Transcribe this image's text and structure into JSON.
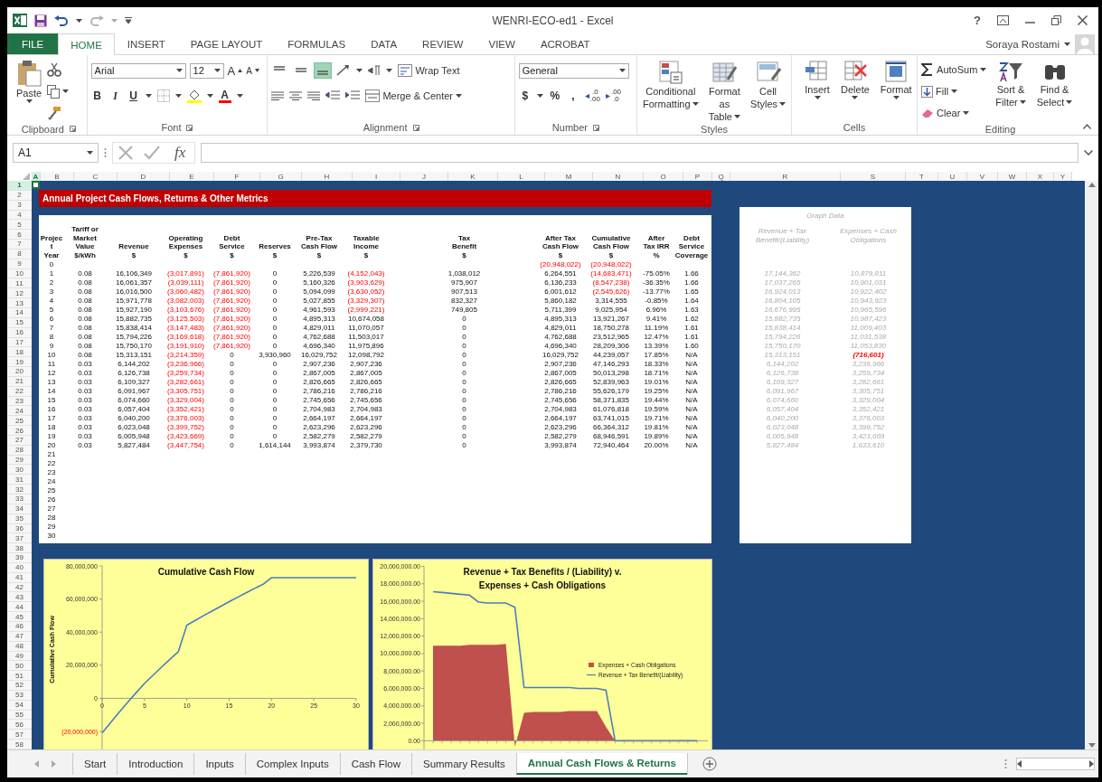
{
  "title_bar": {
    "title": "WENRI-ECO-ed1 - Excel",
    "help": "?"
  },
  "ribbon": {
    "tabs": [
      {
        "label": "FILE",
        "kind": "file",
        "selected": false
      },
      {
        "label": "HOME",
        "kind": "tab",
        "selected": true
      },
      {
        "label": "INSERT",
        "kind": "tab",
        "selected": false
      },
      {
        "label": "PAGE LAYOUT",
        "kind": "tab",
        "selected": false
      },
      {
        "label": "FORMULAS",
        "kind": "tab",
        "selected": false
      },
      {
        "label": "DATA",
        "kind": "tab",
        "selected": false
      },
      {
        "label": "REVIEW",
        "kind": "tab",
        "selected": false
      },
      {
        "label": "VIEW",
        "kind": "tab",
        "selected": false
      },
      {
        "label": "ACROBAT",
        "kind": "tab",
        "selected": false
      }
    ],
    "user": "Soraya Rostami",
    "clipboard": {
      "label": "Clipboard",
      "paste": "Paste"
    },
    "font": {
      "label": "Font",
      "family": "Arial",
      "size": "12",
      "grow": "A",
      "shrink": "A",
      "bold": "B",
      "italic": "I",
      "underline": "U",
      "color_letter": "A"
    },
    "alignment": {
      "label": "Alignment",
      "vertical": [
        {
          "selected": false
        },
        {
          "selected": false
        },
        {
          "selected": true
        }
      ],
      "wrap": "Wrap Text",
      "merge": "Merge & Center"
    },
    "number": {
      "label": "Number",
      "format": "General",
      "currency": "$",
      "percent": "%",
      "comma": ",",
      "decimals": [
        {
          "top": ".0",
          "bottom": ".00"
        },
        {
          "top": ".00",
          "bottom": ".0"
        }
      ]
    },
    "styles": {
      "label": "Styles",
      "buttons": [
        {
          "lines": [
            "Conditional",
            "Formatting"
          ]
        },
        {
          "lines": [
            "Format as",
            "Table"
          ]
        },
        {
          "lines": [
            "Cell",
            "Styles"
          ]
        }
      ]
    },
    "cells": {
      "label": "Cells",
      "buttons": [
        "Insert",
        "Delete",
        "Format"
      ]
    },
    "editing": {
      "label": "Editing",
      "autosum": "AutoSum",
      "fill": "Fill",
      "clear": "Clear",
      "sort": [
        "Sort &",
        "Filter"
      ],
      "find": [
        "Find &",
        "Select"
      ]
    }
  },
  "formula_bar": {
    "name_box": "A1",
    "fx": "fx"
  },
  "columns": [
    {
      "label": "A",
      "selected": true
    },
    {
      "label": "B",
      "selected": false
    },
    {
      "label": "C",
      "selected": false
    },
    {
      "label": "D",
      "selected": false
    },
    {
      "label": "E",
      "selected": false
    },
    {
      "label": "F",
      "selected": false
    },
    {
      "label": "G",
      "selected": false
    },
    {
      "label": "H",
      "selected": false
    },
    {
      "label": "I",
      "selected": false
    },
    {
      "label": "J",
      "selected": false
    },
    {
      "label": "K",
      "selected": false
    },
    {
      "label": "L",
      "selected": false
    },
    {
      "label": "M",
      "selected": false
    },
    {
      "label": "N",
      "selected": false
    },
    {
      "label": "O",
      "selected": false
    },
    {
      "label": "P",
      "selected": false
    },
    {
      "label": "Q",
      "selected": false
    },
    {
      "label": "R",
      "selected": false
    },
    {
      "label": "S",
      "selected": false
    },
    {
      "label": "T",
      "selected": false
    },
    {
      "label": "U",
      "selected": false
    },
    {
      "label": "V",
      "selected": false
    },
    {
      "label": "W",
      "selected": false
    },
    {
      "label": "X",
      "selected": false
    },
    {
      "label": "Y",
      "selected": false
    }
  ],
  "row_headers": [
    {
      "label": "1",
      "selected": true
    },
    {
      "label": "2",
      "selected": false
    },
    {
      "label": "3",
      "selected": false
    },
    {
      "label": "4",
      "selected": false
    },
    {
      "label": "5",
      "selected": false
    },
    {
      "label": "6",
      "selected": false
    },
    {
      "label": "7",
      "selected": false
    },
    {
      "label": "8",
      "selected": false
    },
    {
      "label": "9",
      "selected": false
    },
    {
      "label": "10",
      "selected": false
    },
    {
      "label": "11",
      "selected": false
    },
    {
      "label": "12",
      "selected": false
    },
    {
      "label": "13",
      "selected": false
    },
    {
      "label": "14",
      "selected": false
    },
    {
      "label": "15",
      "selected": false
    },
    {
      "label": "16",
      "selected": false
    },
    {
      "label": "17",
      "selected": false
    },
    {
      "label": "18",
      "selected": false
    },
    {
      "label": "19",
      "selected": false
    },
    {
      "label": "20",
      "selected": false
    },
    {
      "label": "21",
      "selected": false
    },
    {
      "label": "22",
      "selected": false
    },
    {
      "label": "23",
      "selected": false
    },
    {
      "label": "24",
      "selected": false
    },
    {
      "label": "25",
      "selected": false
    },
    {
      "label": "26",
      "selected": false
    },
    {
      "label": "27",
      "selected": false
    },
    {
      "label": "28",
      "selected": false
    },
    {
      "label": "29",
      "selected": false
    },
    {
      "label": "30",
      "selected": false
    },
    {
      "label": "31",
      "selected": false
    },
    {
      "label": "32",
      "selected": false
    },
    {
      "label": "33",
      "selected": false
    },
    {
      "label": "34",
      "selected": false
    },
    {
      "label": "35",
      "selected": false
    },
    {
      "label": "36",
      "selected": false
    },
    {
      "label": "37",
      "selected": false
    },
    {
      "label": "38",
      "selected": false
    },
    {
      "label": "39",
      "selected": false
    },
    {
      "label": "40",
      "selected": false
    },
    {
      "label": "41",
      "selected": false
    },
    {
      "label": "42",
      "selected": false
    },
    {
      "label": "43",
      "selected": false
    },
    {
      "label": "44",
      "selected": false
    },
    {
      "label": "45",
      "selected": false
    },
    {
      "label": "46",
      "selected": false
    },
    {
      "label": "47",
      "selected": false
    },
    {
      "label": "48",
      "selected": false
    },
    {
      "label": "49",
      "selected": false
    },
    {
      "label": "50",
      "selected": false
    },
    {
      "label": "51",
      "selected": false
    },
    {
      "label": "52",
      "selected": false
    },
    {
      "label": "53",
      "selected": false
    },
    {
      "label": "54",
      "selected": false
    },
    {
      "label": "55",
      "selected": false
    },
    {
      "label": "56",
      "selected": false
    },
    {
      "label": "57",
      "selected": false
    },
    {
      "label": "58",
      "selected": false
    }
  ],
  "report": {
    "title": "Annual Project Cash Flows, Returns & Other Metrics",
    "headers": [
      {
        "lines": [
          "Projec",
          "t",
          "Year"
        ]
      },
      {
        "lines": [
          "Tariff or",
          "Market",
          "Value",
          "$/kWh"
        ]
      },
      {
        "lines": [
          "Revenue",
          "$"
        ]
      },
      {
        "lines": [
          "Operating",
          "Expenses",
          "$"
        ]
      },
      {
        "lines": [
          "Debt",
          "Service",
          "$"
        ]
      },
      {
        "lines": [
          "Reserves",
          "$"
        ]
      },
      {
        "lines": [
          "Pre-Tax",
          "Cash Flow",
          "$"
        ]
      },
      {
        "lines": [
          "Taxable",
          "Income",
          "$"
        ]
      },
      {
        "lines": [
          "Tax",
          "Benefit",
          "$"
        ]
      },
      {
        "lines": [
          "After Tax",
          "Cash Flow",
          "$"
        ]
      },
      {
        "lines": [
          "Cumulative",
          "Cash Flow",
          "$"
        ]
      },
      {
        "lines": [
          "After",
          "Tax IRR",
          "%"
        ]
      },
      {
        "lines": [
          "Debt",
          "Service",
          "Coverage"
        ]
      }
    ],
    "rows": [
      {
        "year": "0",
        "kind": "opening",
        "cells": [
          {
            "v": "(20,948,022)",
            "red": true
          },
          {
            "v": "(20,948,022)",
            "red": true
          }
        ]
      },
      {
        "year": "1",
        "kind": "data",
        "cells": [
          {
            "v": "0.08",
            "red": false
          },
          {
            "v": "16,106,349",
            "red": false
          },
          {
            "v": "(3,017,891)",
            "red": true
          },
          {
            "v": "(7,861,920)",
            "red": true
          },
          {
            "v": "0",
            "red": false
          },
          {
            "v": "5,226,539",
            "red": false
          },
          {
            "v": "(4,152,043)",
            "red": true
          },
          {
            "v": "1,038,012",
            "red": false
          },
          {
            "v": "6,264,551",
            "red": false
          },
          {
            "v": "(14,683,471)",
            "red": true
          },
          {
            "v": "-75.05%",
            "red": false
          },
          {
            "v": "1.66",
            "red": false
          }
        ]
      },
      {
        "year": "2",
        "kind": "data",
        "cells": [
          {
            "v": "0.08",
            "red": false
          },
          {
            "v": "16,061,357",
            "red": false
          },
          {
            "v": "(3,039,111)",
            "red": true
          },
          {
            "v": "(7,861,920)",
            "red": true
          },
          {
            "v": "0",
            "red": false
          },
          {
            "v": "5,160,326",
            "red": false
          },
          {
            "v": "(3,903,629)",
            "red": true
          },
          {
            "v": "975,907",
            "red": false
          },
          {
            "v": "6,136,233",
            "red": false
          },
          {
            "v": "(8,547,238)",
            "red": true
          },
          {
            "v": "-36.35%",
            "red": false
          },
          {
            "v": "1.66",
            "red": false
          }
        ]
      },
      {
        "year": "3",
        "kind": "data",
        "cells": [
          {
            "v": "0.08",
            "red": false
          },
          {
            "v": "16,016,500",
            "red": false
          },
          {
            "v": "(3,060,482)",
            "red": true
          },
          {
            "v": "(7,861,920)",
            "red": true
          },
          {
            "v": "0",
            "red": false
          },
          {
            "v": "5,094,099",
            "red": false
          },
          {
            "v": "(3,630,052)",
            "red": true
          },
          {
            "v": "907,513",
            "red": false
          },
          {
            "v": "6,001,612",
            "red": false
          },
          {
            "v": "(2,545,626)",
            "red": true
          },
          {
            "v": "-13.77%",
            "red": false
          },
          {
            "v": "1.65",
            "red": false
          }
        ]
      },
      {
        "year": "4",
        "kind": "data",
        "cells": [
          {
            "v": "0.08",
            "red": false
          },
          {
            "v": "15,971,778",
            "red": false
          },
          {
            "v": "(3,082,003)",
            "red": true
          },
          {
            "v": "(7,861,920)",
            "red": true
          },
          {
            "v": "0",
            "red": false
          },
          {
            "v": "5,027,855",
            "red": false
          },
          {
            "v": "(3,329,307)",
            "red": true
          },
          {
            "v": "832,327",
            "red": false
          },
          {
            "v": "5,860,182",
            "red": false
          },
          {
            "v": "3,314,555",
            "red": false
          },
          {
            "v": "-0.85%",
            "red": false
          },
          {
            "v": "1.64",
            "red": false
          }
        ]
      },
      {
        "year": "5",
        "kind": "data",
        "cells": [
          {
            "v": "0.08",
            "red": false
          },
          {
            "v": "15,927,190",
            "red": false
          },
          {
            "v": "(3,103,676)",
            "red": true
          },
          {
            "v": "(7,861,920)",
            "red": true
          },
          {
            "v": "0",
            "red": false
          },
          {
            "v": "4,961,593",
            "red": false
          },
          {
            "v": "(2,999,221)",
            "red": true
          },
          {
            "v": "749,805",
            "red": false
          },
          {
            "v": "5,711,399",
            "red": false
          },
          {
            "v": "9,025,954",
            "red": false
          },
          {
            "v": "6.96%",
            "red": false
          },
          {
            "v": "1.63",
            "red": false
          }
        ]
      },
      {
        "year": "6",
        "kind": "data",
        "cells": [
          {
            "v": "0.08",
            "red": false
          },
          {
            "v": "15,882,735",
            "red": false
          },
          {
            "v": "(3,125,503)",
            "red": true
          },
          {
            "v": "(7,861,920)",
            "red": true
          },
          {
            "v": "0",
            "red": false
          },
          {
            "v": "4,895,313",
            "red": false
          },
          {
            "v": "10,674,058",
            "red": false
          },
          {
            "v": "0",
            "red": false
          },
          {
            "v": "4,895,313",
            "red": false
          },
          {
            "v": "13,921,267",
            "red": false
          },
          {
            "v": "9.41%",
            "red": false
          },
          {
            "v": "1.62",
            "red": false
          }
        ]
      },
      {
        "year": "7",
        "kind": "data",
        "cells": [
          {
            "v": "0.08",
            "red": false
          },
          {
            "v": "15,838,414",
            "red": false
          },
          {
            "v": "(3,147,483)",
            "red": true
          },
          {
            "v": "(7,861,920)",
            "red": true
          },
          {
            "v": "0",
            "red": false
          },
          {
            "v": "4,829,011",
            "red": false
          },
          {
            "v": "11,070,057",
            "red": false
          },
          {
            "v": "0",
            "red": false
          },
          {
            "v": "4,829,011",
            "red": false
          },
          {
            "v": "18,750,278",
            "red": false
          },
          {
            "v": "11.19%",
            "red": false
          },
          {
            "v": "1.61",
            "red": false
          }
        ]
      },
      {
        "year": "8",
        "kind": "data",
        "cells": [
          {
            "v": "0.08",
            "red": false
          },
          {
            "v": "15,794,226",
            "red": false
          },
          {
            "v": "(3,169,618)",
            "red": true
          },
          {
            "v": "(7,861,920)",
            "red": true
          },
          {
            "v": "0",
            "red": false
          },
          {
            "v": "4,762,688",
            "red": false
          },
          {
            "v": "11,503,017",
            "red": false
          },
          {
            "v": "0",
            "red": false
          },
          {
            "v": "4,762,688",
            "red": false
          },
          {
            "v": "23,512,965",
            "red": false
          },
          {
            "v": "12.47%",
            "red": false
          },
          {
            "v": "1.61",
            "red": false
          }
        ]
      },
      {
        "year": "9",
        "kind": "data",
        "cells": [
          {
            "v": "0.08",
            "red": false
          },
          {
            "v": "15,750,170",
            "red": false
          },
          {
            "v": "(3,191,910)",
            "red": true
          },
          {
            "v": "(7,861,920)",
            "red": true
          },
          {
            "v": "0",
            "red": false
          },
          {
            "v": "4,696,340",
            "red": false
          },
          {
            "v": "11,975,896",
            "red": false
          },
          {
            "v": "0",
            "red": false
          },
          {
            "v": "4,696,340",
            "red": false
          },
          {
            "v": "28,209,306",
            "red": false
          },
          {
            "v": "13.39%",
            "red": false
          },
          {
            "v": "1.60",
            "red": false
          }
        ]
      },
      {
        "year": "10",
        "kind": "data",
        "cells": [
          {
            "v": "0.08",
            "red": false
          },
          {
            "v": "15,313,151",
            "red": false
          },
          {
            "v": "(3,214,359)",
            "red": true
          },
          {
            "v": "0",
            "red": false
          },
          {
            "v": "3,930,960",
            "red": false
          },
          {
            "v": "16,029,752",
            "red": false
          },
          {
            "v": "12,098,792",
            "red": false
          },
          {
            "v": "0",
            "red": false
          },
          {
            "v": "16,029,752",
            "red": false
          },
          {
            "v": "44,239,057",
            "red": false
          },
          {
            "v": "17.85%",
            "red": false
          },
          {
            "v": "N/A",
            "red": false
          }
        ]
      },
      {
        "year": "11",
        "kind": "data",
        "cells": [
          {
            "v": "0.03",
            "red": false
          },
          {
            "v": "6,144,202",
            "red": false
          },
          {
            "v": "(3,236,966)",
            "red": true
          },
          {
            "v": "0",
            "red": false
          },
          {
            "v": "0",
            "red": false
          },
          {
            "v": "2,907,236",
            "red": false
          },
          {
            "v": "2,907,236",
            "red": false
          },
          {
            "v": "0",
            "red": false
          },
          {
            "v": "2,907,236",
            "red": false
          },
          {
            "v": "47,146,293",
            "red": false
          },
          {
            "v": "18.33%",
            "red": false
          },
          {
            "v": "N/A",
            "red": false
          }
        ]
      },
      {
        "year": "12",
        "kind": "data",
        "cells": [
          {
            "v": "0.03",
            "red": false
          },
          {
            "v": "6,126,738",
            "red": false
          },
          {
            "v": "(3,259,734)",
            "red": true
          },
          {
            "v": "0",
            "red": false
          },
          {
            "v": "0",
            "red": false
          },
          {
            "v": "2,867,005",
            "red": false
          },
          {
            "v": "2,867,005",
            "red": false
          },
          {
            "v": "0",
            "red": false
          },
          {
            "v": "2,867,005",
            "red": false
          },
          {
            "v": "50,013,298",
            "red": false
          },
          {
            "v": "18.71%",
            "red": false
          },
          {
            "v": "N/A",
            "red": false
          }
        ]
      },
      {
        "year": "13",
        "kind": "data",
        "cells": [
          {
            "v": "0.03",
            "red": false
          },
          {
            "v": "6,109,327",
            "red": false
          },
          {
            "v": "(3,282,661)",
            "red": true
          },
          {
            "v": "0",
            "red": false
          },
          {
            "v": "0",
            "red": false
          },
          {
            "v": "2,826,665",
            "red": false
          },
          {
            "v": "2,826,665",
            "red": false
          },
          {
            "v": "0",
            "red": false
          },
          {
            "v": "2,826,665",
            "red": false
          },
          {
            "v": "52,839,963",
            "red": false
          },
          {
            "v": "19.01%",
            "red": false
          },
          {
            "v": "N/A",
            "red": false
          }
        ]
      },
      {
        "year": "14",
        "kind": "data",
        "cells": [
          {
            "v": "0.03",
            "red": false
          },
          {
            "v": "6,091,967",
            "red": false
          },
          {
            "v": "(3,305,751)",
            "red": true
          },
          {
            "v": "0",
            "red": false
          },
          {
            "v": "0",
            "red": false
          },
          {
            "v": "2,786,216",
            "red": false
          },
          {
            "v": "2,786,216",
            "red": false
          },
          {
            "v": "0",
            "red": false
          },
          {
            "v": "2,786,216",
            "red": false
          },
          {
            "v": "55,626,179",
            "red": false
          },
          {
            "v": "19.25%",
            "red": false
          },
          {
            "v": "N/A",
            "red": false
          }
        ]
      },
      {
        "year": "15",
        "kind": "data",
        "cells": [
          {
            "v": "0.03",
            "red": false
          },
          {
            "v": "6,074,660",
            "red": false
          },
          {
            "v": "(3,329,004)",
            "red": true
          },
          {
            "v": "0",
            "red": false
          },
          {
            "v": "0",
            "red": false
          },
          {
            "v": "2,745,656",
            "red": false
          },
          {
            "v": "2,745,656",
            "red": false
          },
          {
            "v": "0",
            "red": false
          },
          {
            "v": "2,745,656",
            "red": false
          },
          {
            "v": "58,371,835",
            "red": false
          },
          {
            "v": "19.44%",
            "red": false
          },
          {
            "v": "N/A",
            "red": false
          }
        ]
      },
      {
        "year": "16",
        "kind": "data",
        "cells": [
          {
            "v": "0.03",
            "red": false
          },
          {
            "v": "6,057,404",
            "red": false
          },
          {
            "v": "(3,352,421)",
            "red": true
          },
          {
            "v": "0",
            "red": false
          },
          {
            "v": "0",
            "red": false
          },
          {
            "v": "2,704,983",
            "red": false
          },
          {
            "v": "2,704,983",
            "red": false
          },
          {
            "v": "0",
            "red": false
          },
          {
            "v": "2,704,983",
            "red": false
          },
          {
            "v": "61,076,818",
            "red": false
          },
          {
            "v": "19.59%",
            "red": false
          },
          {
            "v": "N/A",
            "red": false
          }
        ]
      },
      {
        "year": "17",
        "kind": "data",
        "cells": [
          {
            "v": "0.03",
            "red": false
          },
          {
            "v": "6,040,200",
            "red": false
          },
          {
            "v": "(3,376,003)",
            "red": true
          },
          {
            "v": "0",
            "red": false
          },
          {
            "v": "0",
            "red": false
          },
          {
            "v": "2,664,197",
            "red": false
          },
          {
            "v": "2,664,197",
            "red": false
          },
          {
            "v": "0",
            "red": false
          },
          {
            "v": "2,664,197",
            "red": false
          },
          {
            "v": "63,741,015",
            "red": false
          },
          {
            "v": "19.71%",
            "red": false
          },
          {
            "v": "N/A",
            "red": false
          }
        ]
      },
      {
        "year": "18",
        "kind": "data",
        "cells": [
          {
            "v": "0.03",
            "red": false
          },
          {
            "v": "6,023,048",
            "red": false
          },
          {
            "v": "(3,399,752)",
            "red": true
          },
          {
            "v": "0",
            "red": false
          },
          {
            "v": "0",
            "red": false
          },
          {
            "v": "2,623,296",
            "red": false
          },
          {
            "v": "2,623,296",
            "red": false
          },
          {
            "v": "0",
            "red": false
          },
          {
            "v": "2,623,296",
            "red": false
          },
          {
            "v": "66,364,312",
            "red": false
          },
          {
            "v": "19.81%",
            "red": false
          },
          {
            "v": "N/A",
            "red": false
          }
        ]
      },
      {
        "year": "19",
        "kind": "data",
        "cells": [
          {
            "v": "0.03",
            "red": false
          },
          {
            "v": "6,005,948",
            "red": false
          },
          {
            "v": "(3,423,669)",
            "red": true
          },
          {
            "v": "0",
            "red": false
          },
          {
            "v": "0",
            "red": false
          },
          {
            "v": "2,582,279",
            "red": false
          },
          {
            "v": "2,582,279",
            "red": false
          },
          {
            "v": "0",
            "red": false
          },
          {
            "v": "2,582,279",
            "red": false
          },
          {
            "v": "68,946,591",
            "red": false
          },
          {
            "v": "19.89%",
            "red": false
          },
          {
            "v": "N/A",
            "red": false
          }
        ]
      },
      {
        "year": "20",
        "kind": "data",
        "cells": [
          {
            "v": "0.03",
            "red": false
          },
          {
            "v": "5,827,484",
            "red": false
          },
          {
            "v": "(3,447,754)",
            "red": true
          },
          {
            "v": "0",
            "red": false
          },
          {
            "v": "1,614,144",
            "red": false
          },
          {
            "v": "3,993,874",
            "red": false
          },
          {
            "v": "2,379,730",
            "red": false
          },
          {
            "v": "0",
            "red": false
          },
          {
            "v": "3,993,874",
            "red": false
          },
          {
            "v": "72,940,464",
            "red": false
          },
          {
            "v": "20.00%",
            "red": false
          },
          {
            "v": "N/A",
            "red": false
          }
        ]
      },
      {
        "year": "21",
        "kind": "empty"
      },
      {
        "year": "22",
        "kind": "empty"
      },
      {
        "year": "23",
        "kind": "empty"
      },
      {
        "year": "24",
        "kind": "empty"
      },
      {
        "year": "25",
        "kind": "empty"
      },
      {
        "year": "26",
        "kind": "empty"
      },
      {
        "year": "27",
        "kind": "empty"
      },
      {
        "year": "28",
        "kind": "empty"
      },
      {
        "year": "29",
        "kind": "empty"
      },
      {
        "year": "30",
        "kind": "empty"
      }
    ]
  },
  "graph_data": {
    "title": "Graph Data",
    "headers": [
      {
        "lines": [
          "Revenue + Tax",
          "Benefit/(Liability)"
        ]
      },
      {
        "lines": [
          "Expenses + Cash",
          "Obligations"
        ]
      }
    ],
    "rows": [
      {
        "revenue": "17,144,362",
        "expenses": "10,879,811",
        "red": false
      },
      {
        "revenue": "17,037,265",
        "expenses": "10,901,031",
        "red": false
      },
      {
        "revenue": "16,924,013",
        "expenses": "10,922,402",
        "red": false
      },
      {
        "revenue": "16,804,105",
        "expenses": "10,943,923",
        "red": false
      },
      {
        "revenue": "16,676,995",
        "expenses": "10,965,596",
        "red": false
      },
      {
        "revenue": "15,882,735",
        "expenses": "10,987,423",
        "red": false
      },
      {
        "revenue": "15,838,414",
        "expenses": "11,009,403",
        "red": false
      },
      {
        "revenue": "15,794,226",
        "expenses": "11,031,538",
        "red": false
      },
      {
        "revenue": "15,750,170",
        "expenses": "11,053,830",
        "red": false
      },
      {
        "revenue": "15,313,151",
        "expenses": "(716,601)",
        "red": true
      },
      {
        "revenue": "6,144,202",
        "expenses": "3,236,966",
        "red": false
      },
      {
        "revenue": "6,126,738",
        "expenses": "3,259,734",
        "red": false
      },
      {
        "revenue": "6,109,327",
        "expenses": "3,282,661",
        "red": false
      },
      {
        "revenue": "6,091,967",
        "expenses": "3,305,751",
        "red": false
      },
      {
        "revenue": "6,074,660",
        "expenses": "3,329,004",
        "red": false
      },
      {
        "revenue": "6,057,404",
        "expenses": "3,352,421",
        "red": false
      },
      {
        "revenue": "6,040,200",
        "expenses": "3,376,003",
        "red": false
      },
      {
        "revenue": "6,023,048",
        "expenses": "3,399,752",
        "red": false
      },
      {
        "revenue": "6,005,948",
        "expenses": "3,423,669",
        "red": false
      },
      {
        "revenue": "5,827,484",
        "expenses": "1,633,610",
        "red": false
      }
    ]
  },
  "charts": [
    {
      "chart_data": {
        "type": "line",
        "title": "Cumulative Cash Flow",
        "ylabel": "Cumulative Cash Flow",
        "x": [
          0,
          1,
          2,
          3,
          4,
          5,
          6,
          7,
          8,
          9,
          10,
          11,
          12,
          13,
          14,
          15,
          16,
          17,
          18,
          19,
          20,
          21,
          22,
          23,
          24,
          25,
          26,
          27,
          28,
          29,
          30
        ],
        "series": [
          {
            "color": "#4a7ebb",
            "values": [
              -20900000,
              -14700000,
              -8500000,
              -2500000,
              3300000,
              9000000,
              13900000,
              18800000,
              23500000,
              28200000,
              44200000,
              47100000,
              50000000,
              52800000,
              55600000,
              58400000,
              61100000,
              63700000,
              66400000,
              68900000,
              72900000,
              72900000,
              72900000,
              72900000,
              72900000,
              72900000,
              72900000,
              72900000,
              72900000,
              72900000,
              72900000
            ]
          }
        ],
        "xlim": [
          0,
          30
        ],
        "ylim": [
          -32000000,
          80000000
        ],
        "xticks": [
          0,
          5,
          10,
          15,
          20,
          25,
          30
        ],
        "yticks": [
          {
            "value": -20000000,
            "label": "(20,000,000)"
          },
          {
            "value": 0,
            "label": "0"
          },
          {
            "value": 20000000,
            "label": "20,000,000"
          },
          {
            "value": 40000000,
            "label": "40,000,000"
          },
          {
            "value": 60000000,
            "label": "60,000,000"
          },
          {
            "value": 80000000,
            "label": "80,000,000"
          }
        ]
      }
    },
    {
      "chart_data": {
        "type": "area",
        "title": "Revenue + Tax Benefits / (Liability) v. Expenses + Cash Obligations",
        "series": [
          {
            "name": "Expenses + Cash Obligations",
            "type": "area",
            "color": "#c0504d",
            "values": [
              10900000,
              10900000,
              10900000,
              10900000,
              11000000,
              11000000,
              11000000,
              11000000,
              11100000,
              -700000,
              3200000,
              3300000,
              3300000,
              3300000,
              3300000,
              3400000,
              3400000,
              3400000,
              3400000,
              1600000,
              0,
              0,
              0,
              0,
              0,
              0,
              0,
              0,
              0,
              0
            ]
          },
          {
            "name": "Revenue + Tax Benefit/(Liability)",
            "type": "line",
            "color": "#4a7ebb",
            "values": [
              17100000,
              17000000,
              16900000,
              16800000,
              16700000,
              15900000,
              15800000,
              15800000,
              15800000,
              15300000,
              6100000,
              6100000,
              6100000,
              6100000,
              6100000,
              6100000,
              6000000,
              6000000,
              6000000,
              5800000,
              0,
              0,
              0,
              0,
              0,
              0,
              0,
              0,
              0,
              0
            ]
          }
        ],
        "ylim": [
          -1000000,
          20000000
        ],
        "legend": "right",
        "yticks": [
          {
            "value": 0,
            "label": "0.00"
          },
          {
            "value": 2000000,
            "label": "2,000,000.00"
          },
          {
            "value": 4000000,
            "label": "4,000,000.00"
          },
          {
            "value": 6000000,
            "label": "6,000,000.00"
          },
          {
            "value": 8000000,
            "label": "8,000,000.00"
          },
          {
            "value": 10000000,
            "label": "10,000,000.00"
          },
          {
            "value": 12000000,
            "label": "12,000,000.00"
          },
          {
            "value": 14000000,
            "label": "14,000,000.00"
          },
          {
            "value": 16000000,
            "label": "16,000,000.00"
          },
          {
            "value": 18000000,
            "label": "18,000,000.00"
          },
          {
            "value": 20000000,
            "label": "20,000,000.00"
          }
        ]
      }
    }
  ],
  "sheet_tabs": [
    {
      "label": "Start",
      "selected": false
    },
    {
      "label": "Introduction",
      "selected": false
    },
    {
      "label": "Inputs",
      "selected": false
    },
    {
      "label": "Complex Inputs",
      "selected": false
    },
    {
      "label": "Cash Flow",
      "selected": false
    },
    {
      "label": "Summary Results",
      "selected": false
    },
    {
      "label": "Annual Cash Flows & Returns",
      "selected": true
    }
  ]
}
